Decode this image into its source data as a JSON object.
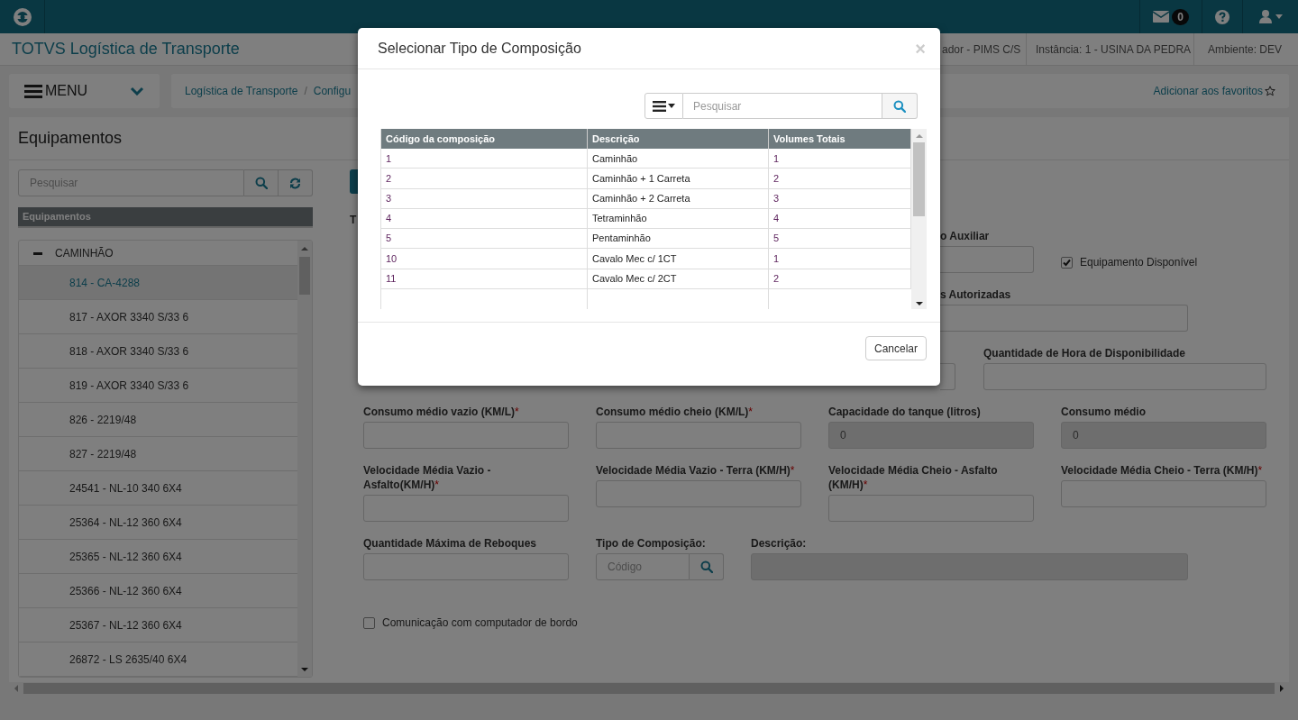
{
  "top_bar": {
    "mail_count": "0"
  },
  "header": {
    "app_title": "TOTVS Logística de Transporte",
    "info": [
      "ador - PIMS C/S",
      "Instância: 1 - USINA DA PEDRA",
      "Ambiente: DEV"
    ]
  },
  "menu_button": "MENU",
  "breadcrumb": {
    "items": [
      "Logística de Transporte",
      "Configu"
    ],
    "separator": "/"
  },
  "favorites_link": "Adicionar aos favoritos",
  "page_title": "Equipamentos",
  "sidebar": {
    "search_placeholder": "Pesquisar",
    "header": "Equipamentos",
    "tree": [
      {
        "label": "CAMINHÃO",
        "expanded": true,
        "children": [
          {
            "label": "814 - CA-4288",
            "selected": true
          },
          {
            "label": "817 - AXOR 3340 S/33 6",
            "selected": false
          },
          {
            "label": "818 - AXOR 3340 S/33 6",
            "selected": false
          },
          {
            "label": "819 - AXOR 3340 S/33 6",
            "selected": false
          },
          {
            "label": "826 - 2219/48",
            "selected": false
          },
          {
            "label": "827 - 2219/48",
            "selected": false
          },
          {
            "label": "24541 - NL-10 340 6X4",
            "selected": false
          },
          {
            "label": "25364 - NL-12 360 6X4",
            "selected": false
          },
          {
            "label": "25365 - NL-12 360 6X4",
            "selected": false
          },
          {
            "label": "25366 - NL-12 360 6X4",
            "selected": false
          },
          {
            "label": "25367 - NL-12 360 6X4",
            "selected": false
          },
          {
            "label": "26872 - LS 2635/40 6X4",
            "selected": false
          }
        ]
      }
    ]
  },
  "form": {
    "cut_label": "T",
    "partial_fields": [
      {
        "label": "o Auxiliar"
      },
      {
        "label": "s Autorizadas"
      },
      {
        "label": "Quantidade de Hora de Disponibilidade"
      }
    ],
    "available_checkbox": {
      "label": "Equipamento Disponível",
      "checked": true
    },
    "rows": [
      [
        {
          "label": "Consumo médio vazio (KM/L)",
          "marker": "*",
          "disabled": false
        },
        {
          "label": "Consumo médio cheio (KM/L)",
          "marker": "*",
          "disabled": false
        },
        {
          "label": "Capacidade do tanque (litros)",
          "value": "0",
          "disabled": true
        },
        {
          "label": "Consumo médio",
          "value": "0",
          "disabled": true
        }
      ],
      [
        {
          "label": "Velocidade Média Vazio - Asfalto(KM/H)",
          "marker": "*",
          "disabled": false
        },
        {
          "label": "Velocidade Média Vazio - Terra (KM/H)",
          "marker": "*",
          "disabled": false
        },
        {
          "label": "Velocidade Média Cheio - Asfalto (KM/H)",
          "marker": "*",
          "disabled": false
        },
        {
          "label": "Velocidade Média Cheio - Terra (KM/H)",
          "marker": "*",
          "disabled": false
        }
      ]
    ],
    "reboques": {
      "label": "Quantidade Máxima de Reboques"
    },
    "composicao": {
      "label": "Tipo de Composição:",
      "placeholder": "Código"
    },
    "descricao": {
      "label": "Descrição:",
      "disabled": true
    },
    "board_checkbox": {
      "label": "Comunicação com computador de bordo",
      "checked": false
    }
  },
  "modal": {
    "title": "Selecionar Tipo de Composição",
    "close": "×",
    "search_placeholder": "Pesquisar",
    "table": {
      "columns": [
        "Código da composição",
        "Descrição",
        "Volumes Totais"
      ],
      "rows": [
        [
          "1",
          "Caminhão",
          "1"
        ],
        [
          "2",
          "Caminhão + 1 Carreta",
          "2"
        ],
        [
          "3",
          "Caminhão + 2 Carreta",
          "3"
        ],
        [
          "4",
          "Tetraminhão",
          "4"
        ],
        [
          "5",
          "Pentaminhão",
          "5"
        ],
        [
          "10",
          "Cavalo Mec c/ 1CT",
          "1"
        ],
        [
          "11",
          "Cavalo Mec c/ 2CT",
          "2"
        ]
      ]
    },
    "cancel_button": "Cancelar"
  }
}
